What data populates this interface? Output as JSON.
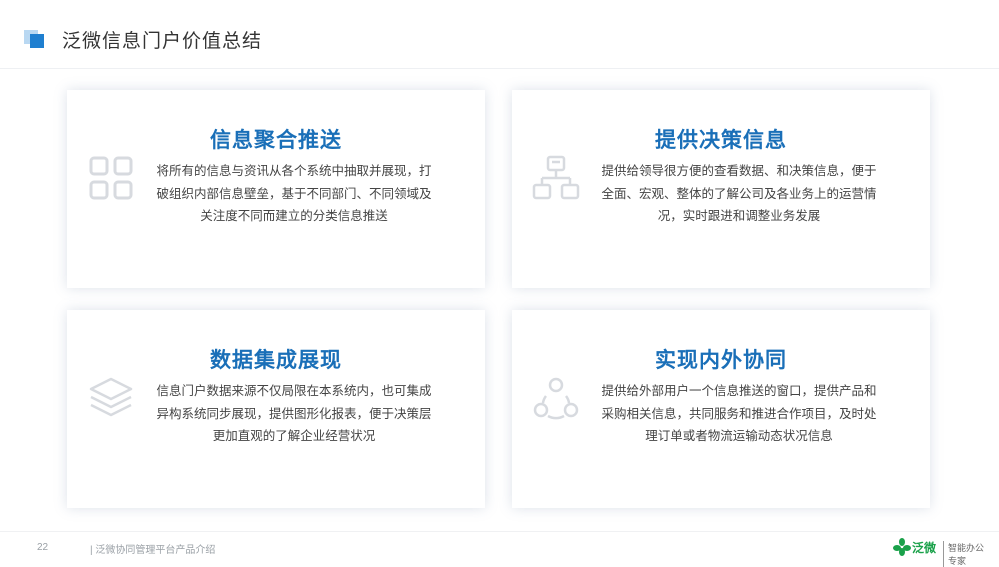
{
  "header": {
    "title": "泛微信息门户价值总结"
  },
  "cards": [
    {
      "title": "信息聚合推送",
      "icon": "grid-icon",
      "lines": [
        "将所有的信息与资讯从各个系统中抽取并展现，打",
        "破组织内部信息壁垒，基于不同部门、不同领域及",
        "关注度不同而建立的分类信息推送"
      ]
    },
    {
      "title": "提供决策信息",
      "icon": "org-chart-icon",
      "lines": [
        "提供给领导很方便的查看数据、和决策信息，便于",
        "全面、宏观、整体的了解公司及各业务上的运营情",
        "况，实时跟进和调整业务发展"
      ]
    },
    {
      "title": "数据集成展现",
      "icon": "layers-icon",
      "lines": [
        "信息门户数据来源不仅局限在本系统内，也可集成",
        "异构系统同步展现，提供图形化报表，便于决策层",
        "更加直观的了解企业经营状况"
      ]
    },
    {
      "title": "实现内外协同",
      "icon": "collaboration-icon",
      "lines": [
        "提供给外部用户一个信息推送的窗口，提供产品和",
        "采购相关信息，共同服务和推进合作项目，及时处",
        "理订单或者物流运输动态状况信息"
      ]
    }
  ],
  "footer": {
    "page_number": "22",
    "text": "| 泛微协同管理平台产品介绍",
    "brand_name": "泛微",
    "brand_slogan": "智能办公专家"
  },
  "colors": {
    "accent": "#1a6fb8",
    "logo_blue": "#1f7fd0",
    "logo_light": "#b9d8f2",
    "brand_green": "#1aa14a"
  }
}
